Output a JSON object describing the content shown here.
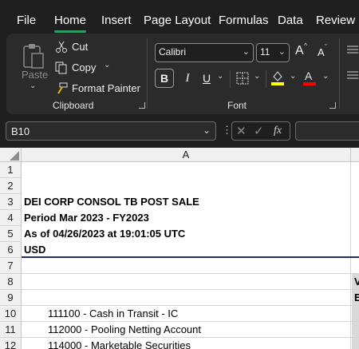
{
  "menu": {
    "items": [
      {
        "label": "File",
        "active": false
      },
      {
        "label": "Home",
        "active": true
      },
      {
        "label": "Insert",
        "active": false
      },
      {
        "label": "Page Layout",
        "active": false
      },
      {
        "label": "Formulas",
        "active": false
      },
      {
        "label": "Data",
        "active": false
      },
      {
        "label": "Review",
        "active": false
      }
    ]
  },
  "ribbon": {
    "clipboard": {
      "paste_label": "Paste",
      "cut_label": "Cut",
      "copy_label": "Copy",
      "format_painter_label": "Format Painter",
      "group_label": "Clipboard"
    },
    "font": {
      "font_name": "Calibri",
      "font_size": "11",
      "grow_label": "A",
      "shrink_label": "A",
      "bold_label": "B",
      "italic_label": "I",
      "underline_label": "U",
      "highlight_color": "#ffff00",
      "font_color": "#ff0000",
      "group_label": "Font"
    }
  },
  "formula_bar": {
    "name_box": "B10",
    "fx_label": "fx"
  },
  "sheet": {
    "column_header": "A",
    "rows": [
      {
        "num": "1",
        "a": "",
        "b": ""
      },
      {
        "num": "2",
        "a": "",
        "b": ""
      },
      {
        "num": "3",
        "a": "DEI CORP CONSOL TB POST SALE",
        "b": "",
        "bold": true
      },
      {
        "num": "4",
        "a": "Period Mar 2023 - FY2023",
        "b": "",
        "bold": true
      },
      {
        "num": "5",
        "a": "As of 04/26/2023 at 19:01:05 UTC",
        "b": "",
        "bold": true
      },
      {
        "num": "6",
        "a": "USD",
        "b": "",
        "bold": true
      },
      {
        "num": "7",
        "a": "",
        "b": ""
      },
      {
        "num": "8",
        "a": "",
        "b": "V"
      },
      {
        "num": "9",
        "a": "",
        "b": "E"
      },
      {
        "num": "10",
        "a": "111100 - Cash in Transit - IC",
        "b": "",
        "indent": true
      },
      {
        "num": "11",
        "a": "112000 - Pooling Netting Account",
        "b": "",
        "indent": true
      },
      {
        "num": "12",
        "a": "114000 - Marketable Securities",
        "b": "",
        "indent": true
      }
    ],
    "accent_line_color": "#1f2f6e"
  }
}
